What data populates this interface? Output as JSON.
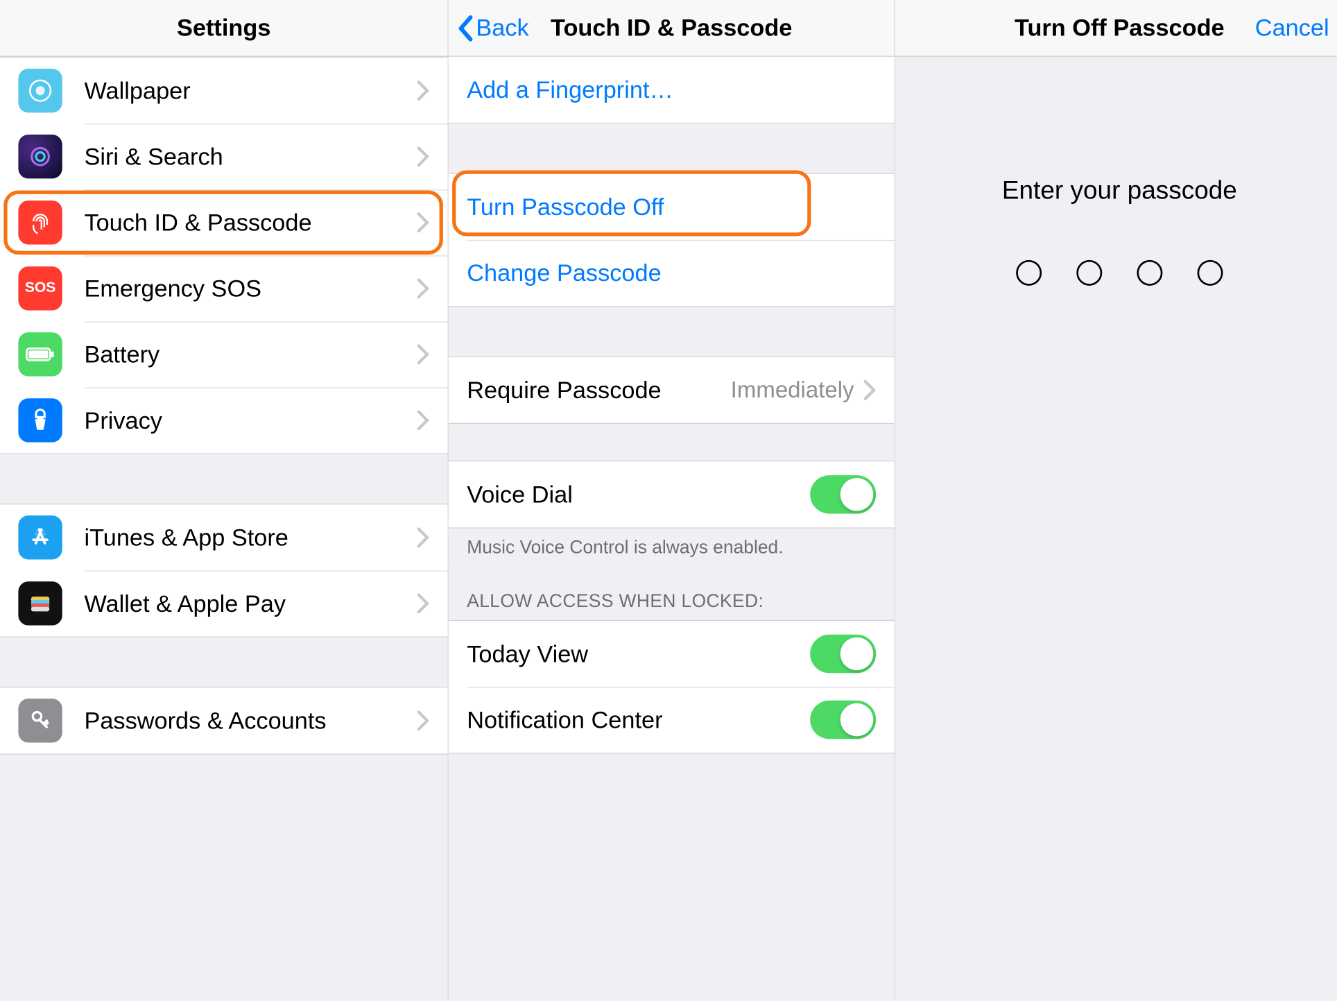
{
  "panel1": {
    "title": "Settings",
    "items": [
      {
        "label": "Wallpaper",
        "icon": "wallpaper-icon"
      },
      {
        "label": "Siri & Search",
        "icon": "siri-icon"
      },
      {
        "label": "Touch ID & Passcode",
        "icon": "fingerprint-icon",
        "highlighted": true
      },
      {
        "label": "Emergency SOS",
        "icon": "sos-icon"
      },
      {
        "label": "Battery",
        "icon": "battery-icon"
      },
      {
        "label": "Privacy",
        "icon": "privacy-icon"
      }
    ],
    "group2": [
      {
        "label": "iTunes & App Store",
        "icon": "appstore-icon"
      },
      {
        "label": "Wallet & Apple Pay",
        "icon": "wallet-icon"
      }
    ],
    "group3": [
      {
        "label": "Passwords & Accounts",
        "icon": "key-icon"
      }
    ]
  },
  "panel2": {
    "back": "Back",
    "title": "Touch ID & Passcode",
    "add_fingerprint": "Add a Fingerprint…",
    "turn_off": "Turn Passcode Off",
    "change": "Change Passcode",
    "require_label": "Require Passcode",
    "require_value": "Immediately",
    "voice_dial": "Voice Dial",
    "voice_note": "Music Voice Control is always enabled.",
    "allow_header": "ALLOW ACCESS WHEN LOCKED:",
    "today_view": "Today View",
    "notification_center": "Notification Center"
  },
  "panel3": {
    "title": "Turn Off Passcode",
    "cancel": "Cancel",
    "prompt": "Enter your passcode"
  },
  "colors": {
    "accent": "#007aff",
    "highlight": "#f97316",
    "toggle_on": "#4cd964"
  }
}
